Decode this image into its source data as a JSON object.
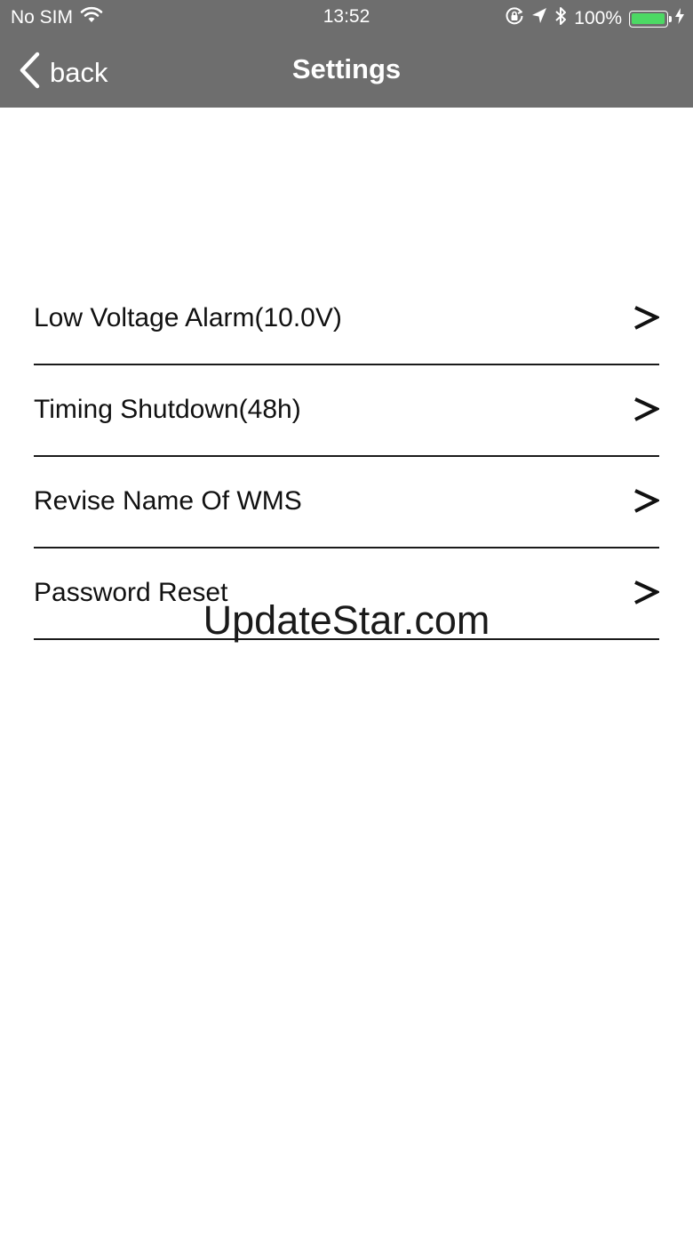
{
  "status_bar": {
    "carrier": "No SIM",
    "time": "13:52",
    "battery_percent": "100%",
    "battery_level": 1.0,
    "battery_color": "#4cd964",
    "icons": [
      "wifi-icon",
      "orientation-lock-icon",
      "location-arrow-icon",
      "bluetooth-icon",
      "battery-icon",
      "charging-bolt-icon"
    ]
  },
  "nav": {
    "back_label": "back",
    "title": "Settings",
    "background_color": "#6e6e6e"
  },
  "settings": {
    "items": [
      {
        "label": "Low Voltage Alarm(10.0V)"
      },
      {
        "label": "Timing Shutdown(48h)"
      },
      {
        "label": "Revise Name Of WMS"
      },
      {
        "label": "Password Reset"
      }
    ],
    "chevron_icon": "chevron-right-icon"
  },
  "watermark": {
    "text": "UpdateStar.com"
  }
}
